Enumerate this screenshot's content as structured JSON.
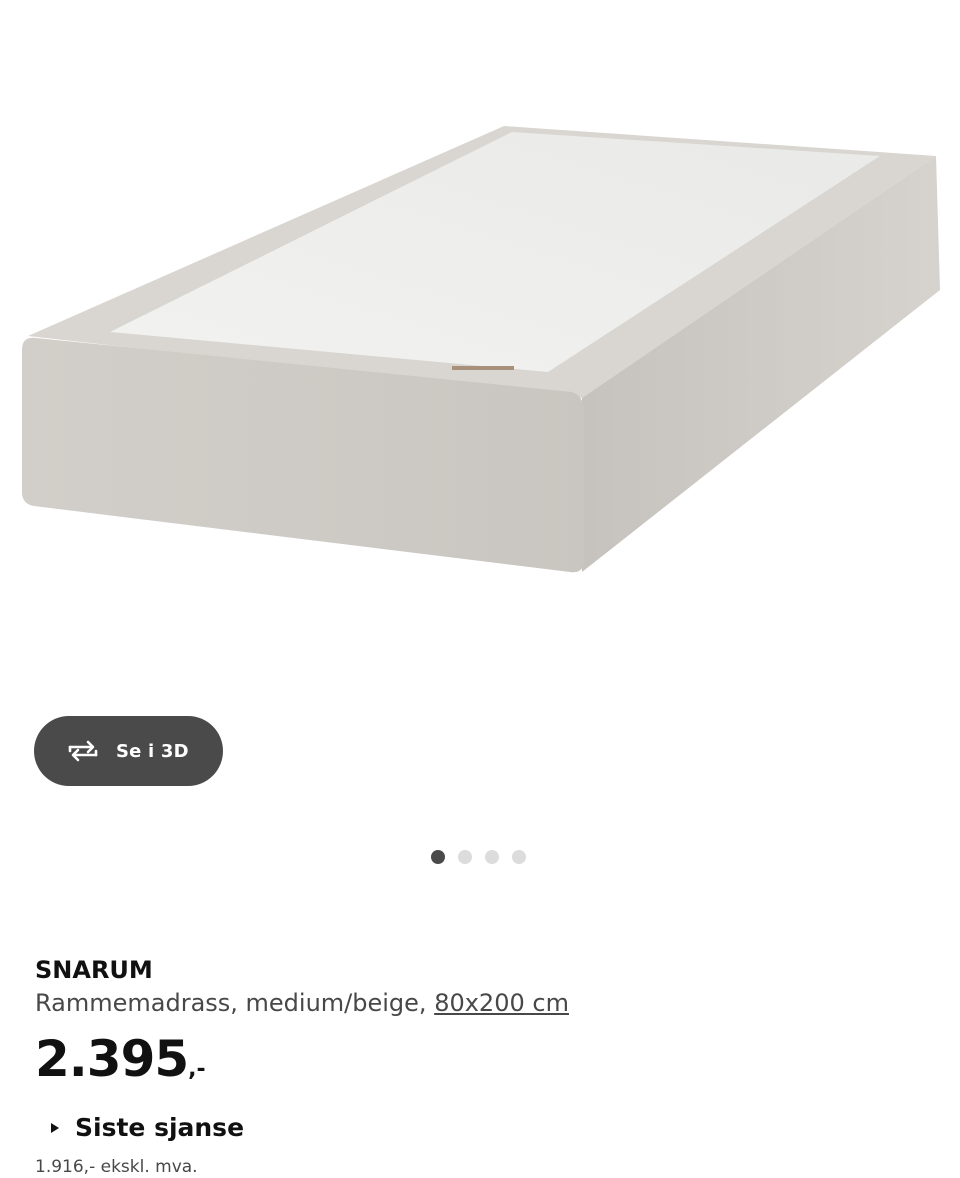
{
  "gallery": {
    "image_alt": "SNARUM rammemadrass",
    "view_3d_label": "Se i 3D",
    "dots_count": 4,
    "active_dot": 0
  },
  "product": {
    "name": "SNARUM",
    "description": "Rammemadrass, medium/beige, ",
    "size_label": "80x200 cm",
    "price_amount": "2.395",
    "price_suffix": ",-",
    "status_label": "Siste sjanse",
    "vat_note": "1.916,- ekskl. mva."
  },
  "colors": {
    "button_bg": "#4a4a4a",
    "dot_active": "#4a4a4a",
    "dot_inactive": "#dcdcdc",
    "mattress_fabric": "#cfcbc6",
    "mattress_top": "#efefed"
  }
}
